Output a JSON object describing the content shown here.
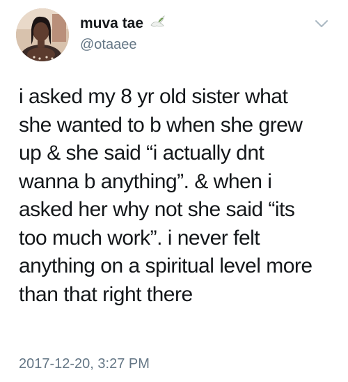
{
  "user": {
    "display_name": "muva tae",
    "handle": "@otaaee",
    "avatar_icon": "profile-photo",
    "name_emoji_icon": "dove-icon"
  },
  "tweet": {
    "lines": [
      "i asked my 8 yr old sister what",
      "she wanted to b when she grew",
      "up & she said “i actually dnt",
      "wanna b anything”. & when i",
      "asked her why not she said “its",
      "too much work”. i never felt",
      "anything on a spiritual level more",
      "than that right there"
    ],
    "timestamp": "2017-12-20, 3:27 PM"
  },
  "controls": {
    "menu_icon": "chevron-down-icon"
  },
  "colors": {
    "text": "#14171a",
    "secondary": "#657786",
    "caret": "#aab8c2"
  }
}
